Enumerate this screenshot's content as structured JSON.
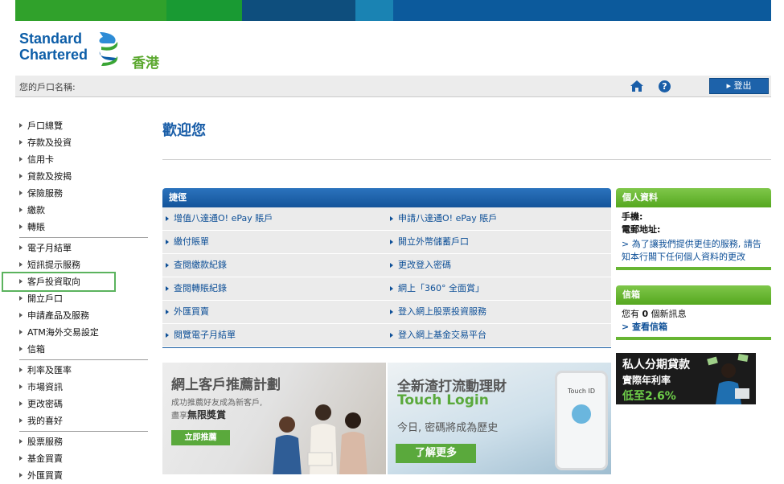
{
  "colors": {
    "bar": [
      "#30a12b",
      "#0f7f3b",
      "#0e4e7d",
      "#1a83b3",
      "#0c5a9c"
    ],
    "blue": "#1a5ea8",
    "green": "#5aa93c"
  },
  "logo": {
    "line1": "Standard",
    "line2": "Chartered",
    "region": "香港"
  },
  "account": {
    "label": "您的戶口名稱:"
  },
  "header": {
    "logout": "登出",
    "home_icon": "home-icon",
    "help_icon": "?"
  },
  "sidebar": {
    "group1": [
      "戶口總覽",
      "存款及投資",
      "信用卡",
      "貸款及按揭",
      "保險服務",
      "繳款",
      "轉賬"
    ],
    "group2": [
      "電子月結單",
      "短訊提示服務",
      "客戶投資取向",
      "開立戶口",
      "申請產品及服務",
      "ATM海外交易設定",
      "信箱"
    ],
    "group3": [
      "利率及匯率",
      "市場資訊",
      "更改密碼",
      "我的喜好"
    ],
    "group4": [
      "股票服務",
      "基金買賣",
      "外匯買賣"
    ]
  },
  "main": {
    "welcome": "歡迎您"
  },
  "quick": {
    "title": "捷徑",
    "rows": [
      [
        "增值八達通O! ePay 賬戶",
        "申請八達通O! ePay 賬戶"
      ],
      [
        "繳付賬單",
        "開立外幣儲蓄戶口"
      ],
      [
        "查閱繳款紀錄",
        "更改登入密碼"
      ],
      [
        "查閱轉賬紀錄",
        "網上「360° 全面賞」"
      ],
      [
        "外匯買賣",
        "登入網上股票投資服務"
      ],
      [
        "閱覽電子月結單",
        "登入網上基金交易平台"
      ]
    ]
  },
  "profile": {
    "title": "個人資料",
    "mobile": "手機:",
    "email": "電郵地址:",
    "link": "> 為了讓我們提供更佳的服務, 請告知本行閣下任何個人資料的更改"
  },
  "mailbox": {
    "title": "信箱",
    "msg_pre": "您有",
    "count": "0",
    "msg_post": "個新訊息",
    "link": "> 查看信箱"
  },
  "banners": {
    "referral": {
      "title": "網上客戶推薦計劃",
      "line1": "成功推薦好友成為新客戶,",
      "line2_pre": "盡享",
      "line2_bold": "無限獎賞",
      "button": "立即推薦"
    },
    "touch": {
      "title": "全新渣打流動理財",
      "subtitle": "Touch Login",
      "line": "今日, 密碼將成為歷史",
      "button": "了解更多",
      "phone": "Touch ID"
    },
    "loan": {
      "line1": "私人分期貸款",
      "line2": "實際年利率",
      "line3": "低至2.6%"
    }
  }
}
